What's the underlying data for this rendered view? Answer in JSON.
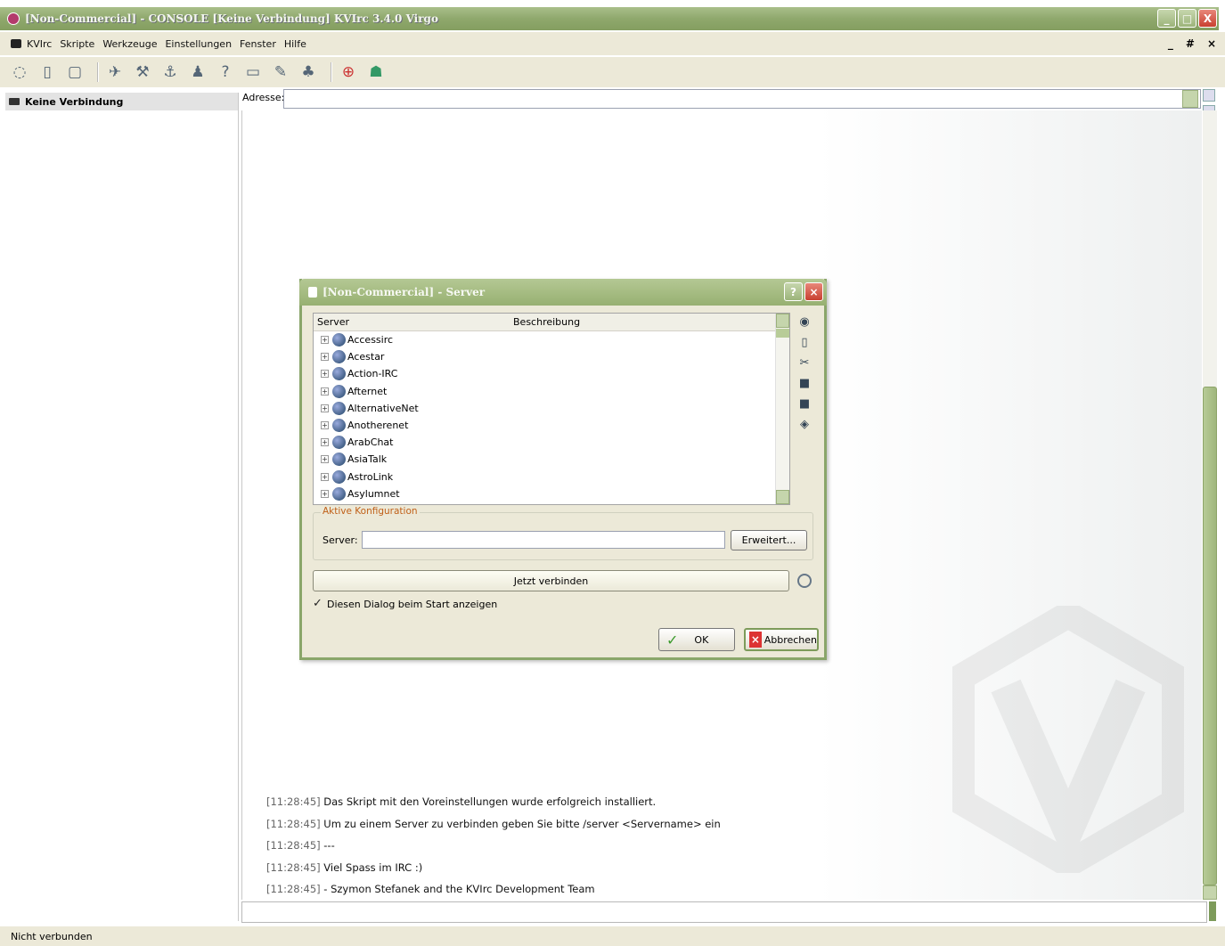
{
  "window": {
    "title": "[Non-Commercial] - CONSOLE [Keine Verbindung] KVIrc 3.4.0 Virgo",
    "buttons": {
      "minimize": "_",
      "maximize": "□",
      "close": "X"
    }
  },
  "menu": {
    "items": [
      "KVIrc",
      "Skripte",
      "Werkzeuge",
      "Einstellungen",
      "Fenster",
      "Hilfe"
    ],
    "right": {
      "minimize": "_",
      "restore": "#",
      "close": "×"
    }
  },
  "toolbar": {
    "icons": [
      "connect-icon",
      "server-icon",
      "window-icon",
      "tools-icon",
      "wrench-icon",
      "anchor-icon",
      "user-icon",
      "help-icon",
      "terminal-icon",
      "edit-icon",
      "network-icon",
      "lifebuoy-icon",
      "kvirc-icon"
    ]
  },
  "tree": {
    "header": "Keine Verbindung"
  },
  "address": {
    "label": "Adresse:",
    "value": ""
  },
  "log": [
    {
      "ts": "[11:28:45]",
      "text": "Das Skript mit den Voreinstellungen wurde erfolgreich installiert."
    },
    {
      "ts": "[11:28:45]",
      "text": "Um zu einem Server zu verbinden geben Sie bitte /server <Servername> ein"
    },
    {
      "ts": "[11:28:45]",
      "text": "---"
    },
    {
      "ts": "[11:28:45]",
      "text": "Viel Spass im IRC :)"
    },
    {
      "ts": "[11:28:45]",
      "text": "- Szymon Stefanek and the KVIrc Development Team"
    }
  ],
  "status": {
    "text": "Nicht verbunden"
  },
  "dialog": {
    "title": "[Non-Commercial] - Server",
    "columns": {
      "server": "Server",
      "description": "Beschreibung"
    },
    "networks": [
      "Accessirc",
      "Acestar",
      "Action-IRC",
      "Afternet",
      "AlternativeNet",
      "Anotherenet",
      "ArabChat",
      "AsiaTalk",
      "AstroLink",
      "Asylumnet"
    ],
    "active_config": {
      "legend": "Aktive Konfiguration",
      "server_label": "Server:",
      "server_value": "",
      "advanced_button": "Erweitert..."
    },
    "connect_button": "Jetzt verbinden",
    "show_on_start": "Diesen Dialog beim Start anzeigen",
    "ok_button": "OK",
    "cancel_button": "Abbrechen"
  }
}
